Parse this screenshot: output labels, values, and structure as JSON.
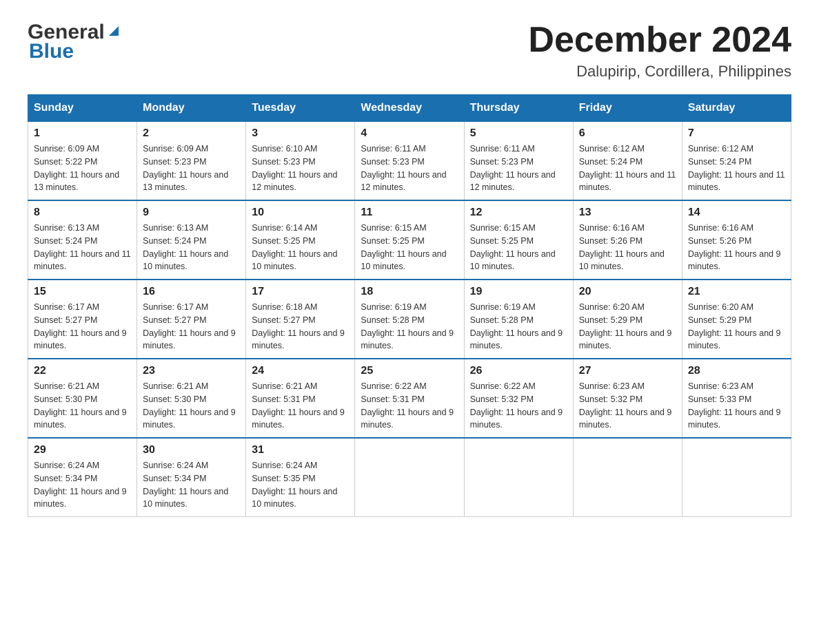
{
  "header": {
    "logo_general": "General",
    "logo_blue": "Blue",
    "month_title": "December 2024",
    "location": "Dalupirip, Cordillera, Philippines"
  },
  "weekdays": [
    "Sunday",
    "Monday",
    "Tuesday",
    "Wednesday",
    "Thursday",
    "Friday",
    "Saturday"
  ],
  "weeks": [
    [
      {
        "day": "1",
        "sunrise": "6:09 AM",
        "sunset": "5:22 PM",
        "daylight": "11 hours and 13 minutes."
      },
      {
        "day": "2",
        "sunrise": "6:09 AM",
        "sunset": "5:23 PM",
        "daylight": "11 hours and 13 minutes."
      },
      {
        "day": "3",
        "sunrise": "6:10 AM",
        "sunset": "5:23 PM",
        "daylight": "11 hours and 12 minutes."
      },
      {
        "day": "4",
        "sunrise": "6:11 AM",
        "sunset": "5:23 PM",
        "daylight": "11 hours and 12 minutes."
      },
      {
        "day": "5",
        "sunrise": "6:11 AM",
        "sunset": "5:23 PM",
        "daylight": "11 hours and 12 minutes."
      },
      {
        "day": "6",
        "sunrise": "6:12 AM",
        "sunset": "5:24 PM",
        "daylight": "11 hours and 11 minutes."
      },
      {
        "day": "7",
        "sunrise": "6:12 AM",
        "sunset": "5:24 PM",
        "daylight": "11 hours and 11 minutes."
      }
    ],
    [
      {
        "day": "8",
        "sunrise": "6:13 AM",
        "sunset": "5:24 PM",
        "daylight": "11 hours and 11 minutes."
      },
      {
        "day": "9",
        "sunrise": "6:13 AM",
        "sunset": "5:24 PM",
        "daylight": "11 hours and 10 minutes."
      },
      {
        "day": "10",
        "sunrise": "6:14 AM",
        "sunset": "5:25 PM",
        "daylight": "11 hours and 10 minutes."
      },
      {
        "day": "11",
        "sunrise": "6:15 AM",
        "sunset": "5:25 PM",
        "daylight": "11 hours and 10 minutes."
      },
      {
        "day": "12",
        "sunrise": "6:15 AM",
        "sunset": "5:25 PM",
        "daylight": "11 hours and 10 minutes."
      },
      {
        "day": "13",
        "sunrise": "6:16 AM",
        "sunset": "5:26 PM",
        "daylight": "11 hours and 10 minutes."
      },
      {
        "day": "14",
        "sunrise": "6:16 AM",
        "sunset": "5:26 PM",
        "daylight": "11 hours and 9 minutes."
      }
    ],
    [
      {
        "day": "15",
        "sunrise": "6:17 AM",
        "sunset": "5:27 PM",
        "daylight": "11 hours and 9 minutes."
      },
      {
        "day": "16",
        "sunrise": "6:17 AM",
        "sunset": "5:27 PM",
        "daylight": "11 hours and 9 minutes."
      },
      {
        "day": "17",
        "sunrise": "6:18 AM",
        "sunset": "5:27 PM",
        "daylight": "11 hours and 9 minutes."
      },
      {
        "day": "18",
        "sunrise": "6:19 AM",
        "sunset": "5:28 PM",
        "daylight": "11 hours and 9 minutes."
      },
      {
        "day": "19",
        "sunrise": "6:19 AM",
        "sunset": "5:28 PM",
        "daylight": "11 hours and 9 minutes."
      },
      {
        "day": "20",
        "sunrise": "6:20 AM",
        "sunset": "5:29 PM",
        "daylight": "11 hours and 9 minutes."
      },
      {
        "day": "21",
        "sunrise": "6:20 AM",
        "sunset": "5:29 PM",
        "daylight": "11 hours and 9 minutes."
      }
    ],
    [
      {
        "day": "22",
        "sunrise": "6:21 AM",
        "sunset": "5:30 PM",
        "daylight": "11 hours and 9 minutes."
      },
      {
        "day": "23",
        "sunrise": "6:21 AM",
        "sunset": "5:30 PM",
        "daylight": "11 hours and 9 minutes."
      },
      {
        "day": "24",
        "sunrise": "6:21 AM",
        "sunset": "5:31 PM",
        "daylight": "11 hours and 9 minutes."
      },
      {
        "day": "25",
        "sunrise": "6:22 AM",
        "sunset": "5:31 PM",
        "daylight": "11 hours and 9 minutes."
      },
      {
        "day": "26",
        "sunrise": "6:22 AM",
        "sunset": "5:32 PM",
        "daylight": "11 hours and 9 minutes."
      },
      {
        "day": "27",
        "sunrise": "6:23 AM",
        "sunset": "5:32 PM",
        "daylight": "11 hours and 9 minutes."
      },
      {
        "day": "28",
        "sunrise": "6:23 AM",
        "sunset": "5:33 PM",
        "daylight": "11 hours and 9 minutes."
      }
    ],
    [
      {
        "day": "29",
        "sunrise": "6:24 AM",
        "sunset": "5:34 PM",
        "daylight": "11 hours and 9 minutes."
      },
      {
        "day": "30",
        "sunrise": "6:24 AM",
        "sunset": "5:34 PM",
        "daylight": "11 hours and 10 minutes."
      },
      {
        "day": "31",
        "sunrise": "6:24 AM",
        "sunset": "5:35 PM",
        "daylight": "11 hours and 10 minutes."
      },
      null,
      null,
      null,
      null
    ]
  ]
}
